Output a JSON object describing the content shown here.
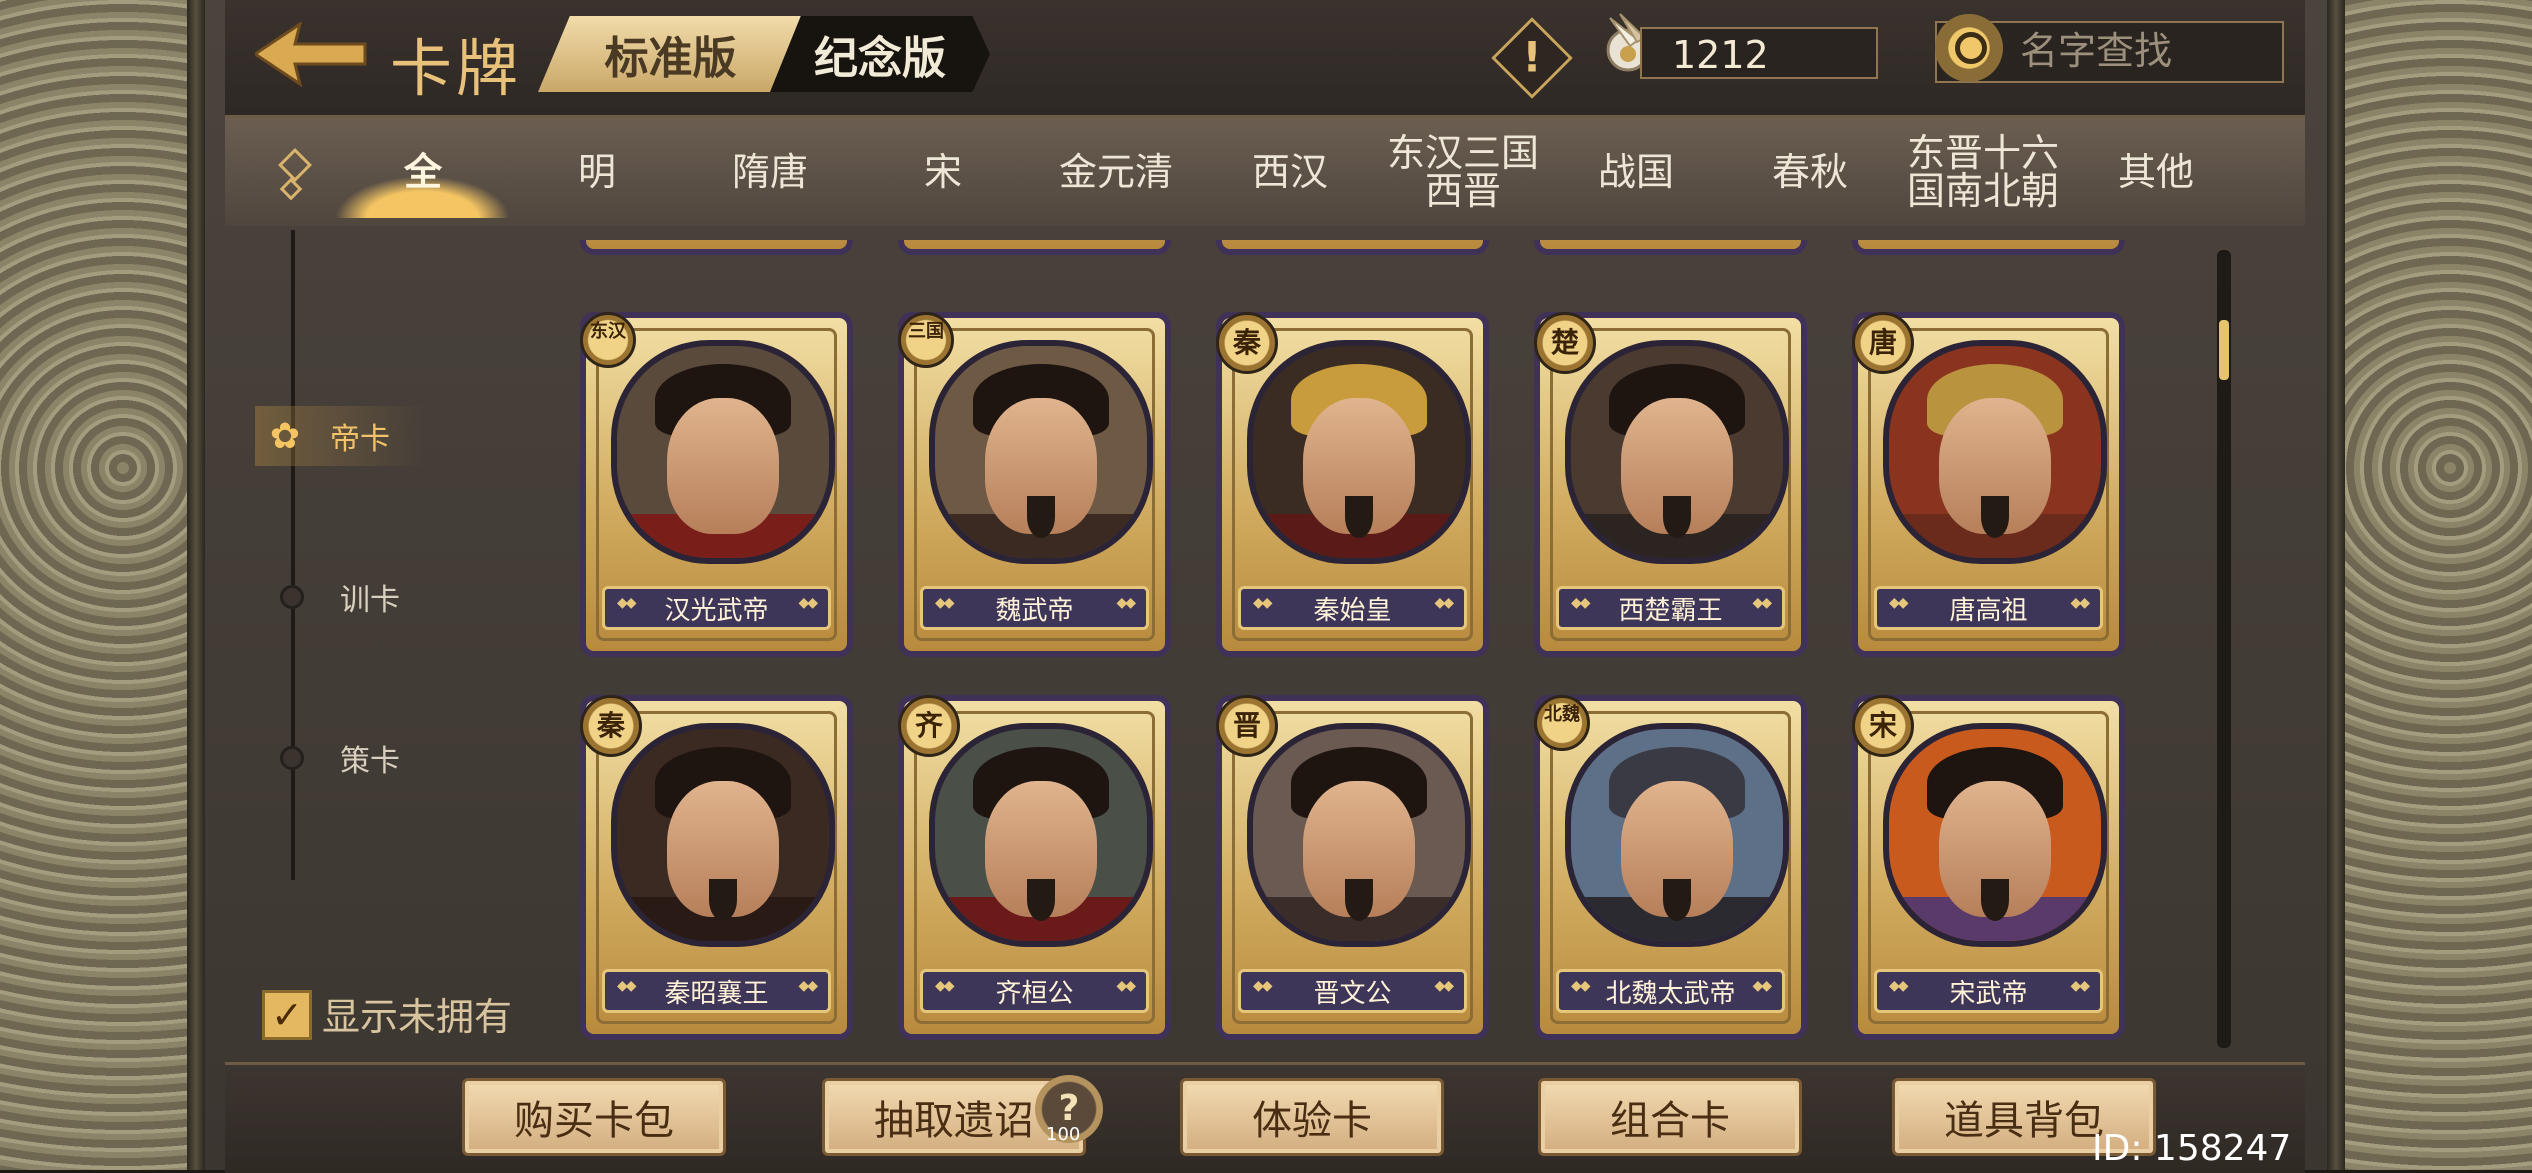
{
  "header": {
    "title": "卡牌",
    "edition_standard": "标准版",
    "edition_commemorative": "纪念版",
    "alert_symbol": "!",
    "currency_amount": "1212",
    "search_placeholder": "名字查找"
  },
  "eras": [
    "全",
    "明",
    "隋唐",
    "宋",
    "金元清",
    "西汉",
    "东汉三国西晋",
    "战国",
    "春秋",
    "东晋十六国南北朝",
    "其他"
  ],
  "sidebar": {
    "categories": [
      "帝卡",
      "训卡",
      "策卡"
    ],
    "show_unowned_label": "显示未拥有",
    "show_unowned_checked": true
  },
  "cards": [
    {
      "name": "汉光武帝",
      "era": "东汉"
    },
    {
      "name": "魏武帝",
      "era": "三国"
    },
    {
      "name": "秦始皇",
      "era": "秦"
    },
    {
      "name": "西楚霸王",
      "era": "楚"
    },
    {
      "name": "唐高祖",
      "era": "唐"
    },
    {
      "name": "秦昭襄王",
      "era": "秦"
    },
    {
      "name": "齐桓公",
      "era": "齐"
    },
    {
      "name": "晋文公",
      "era": "晋"
    },
    {
      "name": "北魏太武帝",
      "era": "北魏"
    },
    {
      "name": "宋武帝",
      "era": "宋"
    }
  ],
  "footer": {
    "buy_pack": "购买卡包",
    "draw_edict": "抽取遗诏",
    "draw_badge": "?",
    "draw_count": "100",
    "trial_card": "体验卡",
    "combo_card": "组合卡",
    "item_bag": "道具背包",
    "user_id": "ID: 158247"
  },
  "colors": {
    "accent_gold": "#e8c27a",
    "panel_bg": "#3c3631",
    "card_plate": "#3d3658"
  }
}
